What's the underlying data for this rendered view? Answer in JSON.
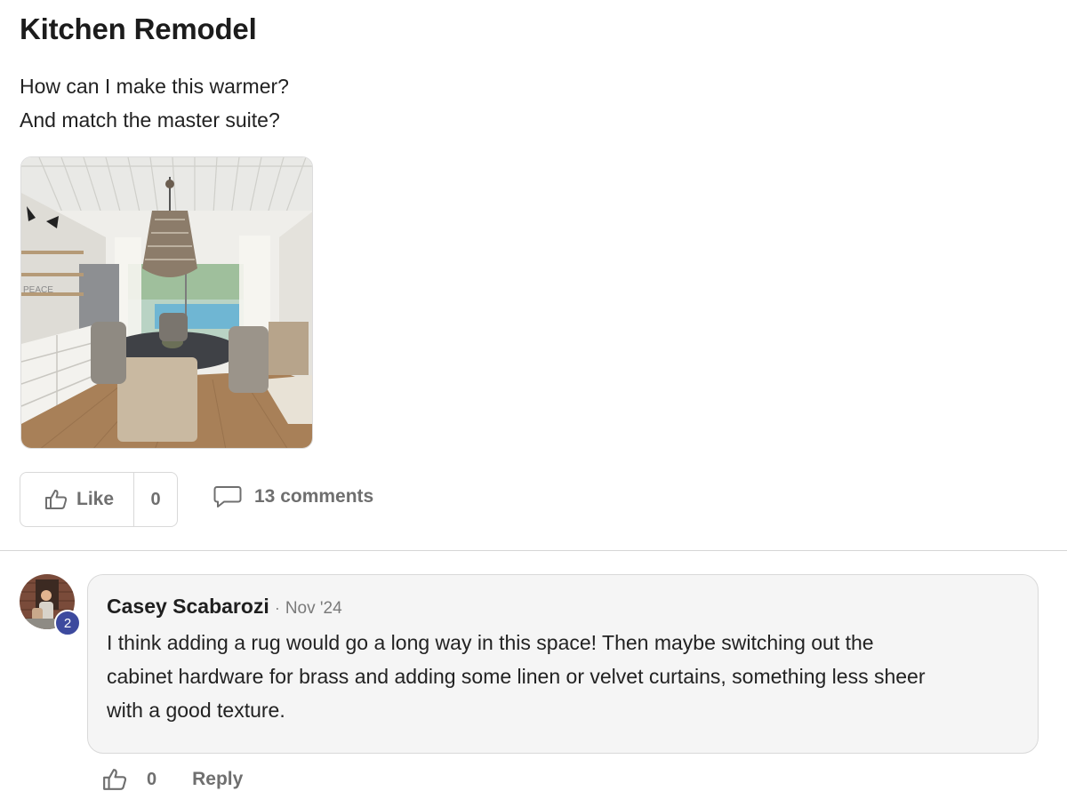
{
  "post": {
    "title": "Kitchen Remodel",
    "body_lines": [
      "How can I make this warmer?",
      "And match the master suite?"
    ],
    "image_sign_text": "PEACE"
  },
  "actions": {
    "like_label": "Like",
    "like_count": "0",
    "comments_label": "13 comments",
    "icons": [
      "thumbs-up-icon",
      "comment-bubble-icon"
    ]
  },
  "comment": {
    "author": "Casey Scabarozi",
    "separator": "·",
    "date": "Nov '24",
    "badge": "2",
    "text_lines": [
      "I think adding a rug would go a long way in this space! Then maybe switching out the",
      "cabinet hardware for brass and adding some linen or velvet curtains, something less sheer",
      "with a good texture."
    ],
    "like_count": "0",
    "reply_label": "Reply"
  },
  "colors": {
    "muted_text": "#6f6f6f",
    "badge_bg": "#3d4a9e",
    "comment_bg": "#f5f5f5",
    "border": "#d9d9d9"
  }
}
